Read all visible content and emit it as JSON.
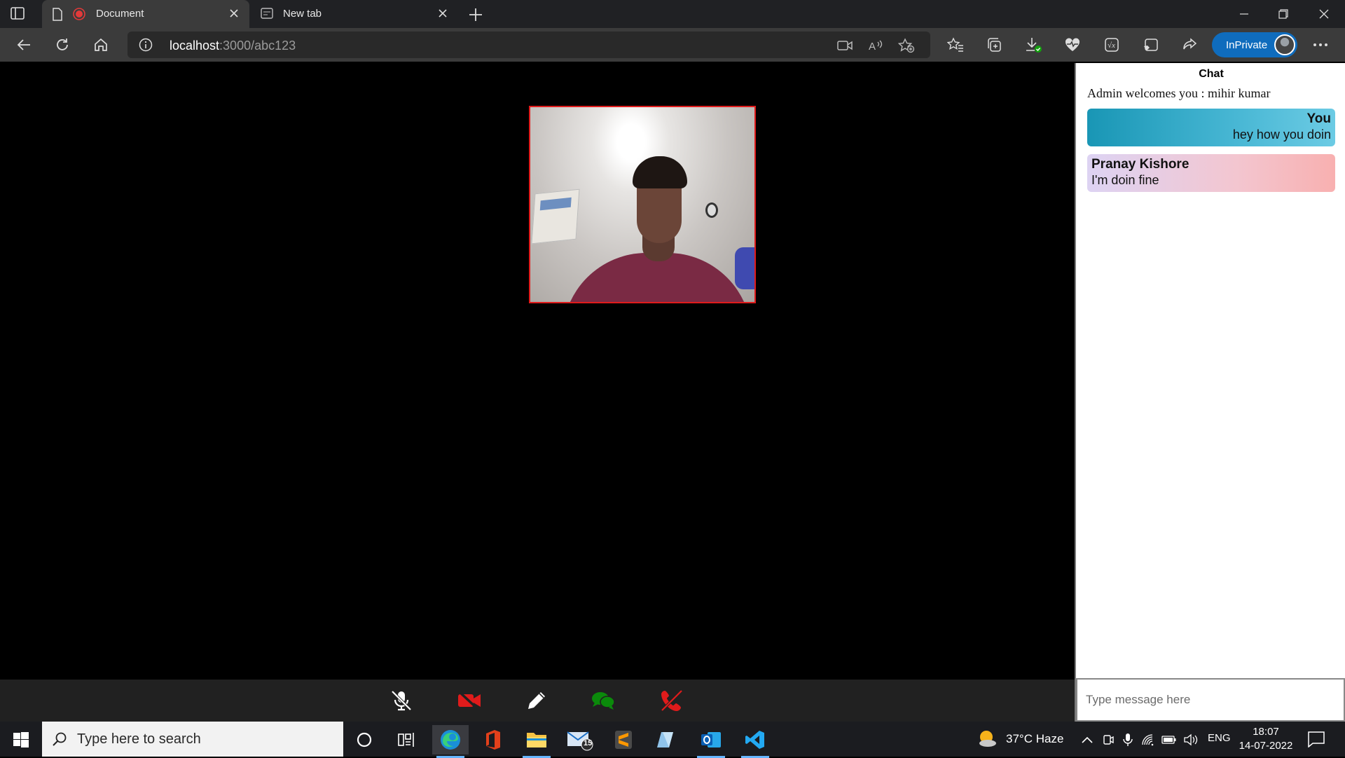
{
  "browser": {
    "tabs": [
      {
        "title": "Document",
        "active": true,
        "recording": true
      },
      {
        "title": "New tab",
        "active": false
      }
    ],
    "address": {
      "host": "localhost",
      "path": ":3000/abc123"
    },
    "inprivate_label": "InPrivate"
  },
  "controls": [
    {
      "name": "mute-mic",
      "icon": "mic-off-icon",
      "color": "#ffffff"
    },
    {
      "name": "video-off",
      "icon": "video-off-icon",
      "color": "#e01b1b"
    },
    {
      "name": "whiteboard",
      "icon": "pencil-icon",
      "color": "#ffffff"
    },
    {
      "name": "chat",
      "icon": "chat-icon",
      "color": "#0b8a0b"
    },
    {
      "name": "leave-call",
      "icon": "phone-hangup-icon",
      "color": "#e01b1b"
    }
  ],
  "chat": {
    "header": "Chat",
    "welcome": "Admin welcomes you : mihir kumar",
    "messages": [
      {
        "sender": "You",
        "text": "hey how you doin",
        "mine": true
      },
      {
        "sender": "Pranay Kishore",
        "text": "I'm doin fine",
        "mine": false
      }
    ],
    "input_placeholder": "Type message here"
  },
  "taskbar": {
    "search_placeholder": "Type here to search",
    "mail_badge": "15",
    "weather": "37°C  Haze",
    "language": "ENG",
    "time": "18:07",
    "date": "14-07-2022"
  }
}
